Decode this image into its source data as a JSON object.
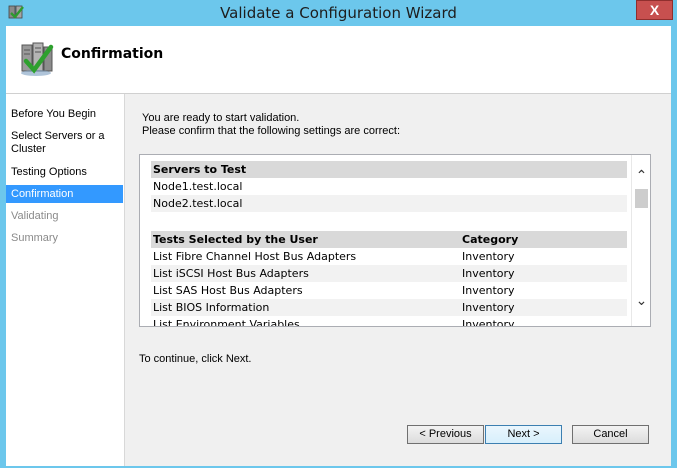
{
  "window": {
    "title": "Validate a Configuration Wizard",
    "close_label": "X"
  },
  "header": {
    "title": "Confirmation",
    "icon": "servers-checkmark-icon"
  },
  "nav": {
    "items": [
      {
        "label": "Before You Begin",
        "state": "normal"
      },
      {
        "label": "Select Servers or a Cluster",
        "state": "normal"
      },
      {
        "label": "Testing Options",
        "state": "normal"
      },
      {
        "label": "Confirmation",
        "state": "active"
      },
      {
        "label": "Validating",
        "state": "disabled"
      },
      {
        "label": "Summary",
        "state": "disabled"
      }
    ]
  },
  "main": {
    "intro_line1": "You are ready to start validation.",
    "intro_line2": "Please confirm that the following settings are correct:",
    "servers_header": "Servers to Test",
    "servers": [
      "Node1.test.local",
      "Node2.test.local"
    ],
    "tests_header": "Tests Selected by the User",
    "category_header": "Category",
    "tests": [
      {
        "name": "List Fibre Channel Host Bus Adapters",
        "category": "Inventory"
      },
      {
        "name": "List iSCSI Host Bus Adapters",
        "category": "Inventory"
      },
      {
        "name": "List SAS Host Bus Adapters",
        "category": "Inventory"
      },
      {
        "name": "List BIOS Information",
        "category": "Inventory"
      },
      {
        "name": "List Environment Variables",
        "category": "Inventory"
      }
    ],
    "continue_text": "To continue, click Next."
  },
  "buttons": {
    "previous": "< Previous",
    "next": "Next >",
    "cancel": "Cancel"
  }
}
